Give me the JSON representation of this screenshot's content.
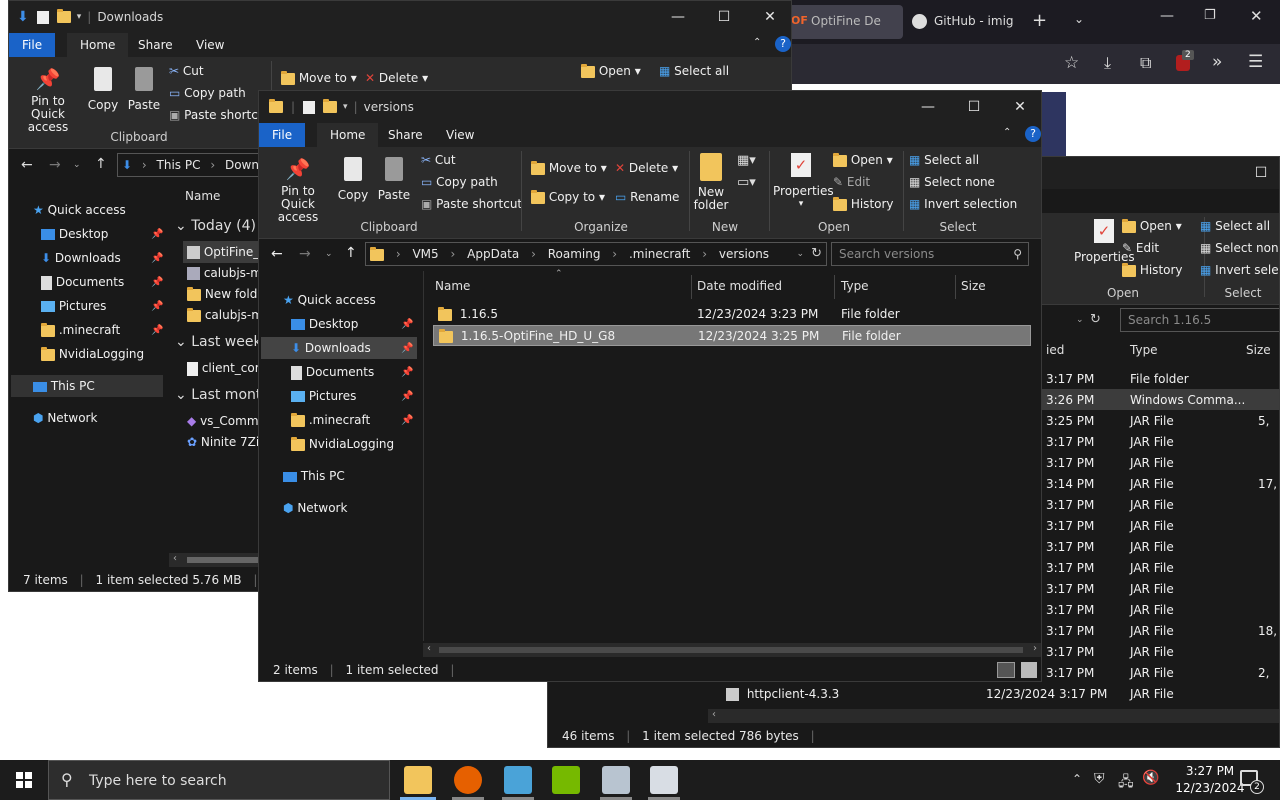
{
  "browser": {
    "tab1": "OptiFine De",
    "tab1_badge": "OF",
    "tab2": "GitHub - imig",
    "new_tab": "+",
    "ext_badge": "2"
  },
  "win_back": {
    "title": "Downloads",
    "tabs": [
      "File",
      "Home",
      "Share",
      "View"
    ],
    "ribbon": {
      "pin": "Pin to Quick access",
      "copy": "Copy",
      "paste": "Paste",
      "cut": "Cut",
      "copy_path": "Copy path",
      "paste_shortcut": "Paste shortcut",
      "clipboard": "Clipboard",
      "move_to": "Move to",
      "delete": "Delete",
      "open": "Open",
      "select_all": "Select all"
    },
    "address": [
      "This PC",
      "Downlo"
    ],
    "nav": [
      "Quick access",
      "Desktop",
      "Downloads",
      "Documents",
      "Pictures",
      ".minecraft",
      "NvidiaLogging",
      "This PC",
      "Network"
    ],
    "col_name": "Name",
    "groups": [
      "Today (4)",
      "Last week",
      "Last month"
    ],
    "files": [
      "OptiFine_",
      "calubjs-m",
      "New folde",
      "calubjs-m",
      "client_cor",
      "vs_Comm",
      "Ninite 7Zi"
    ],
    "status_items": "7 items",
    "status_sel": "1 item selected  5.76 MB"
  },
  "win_right": {
    "ribbon": {
      "properties": "Properties",
      "open": "Open",
      "edit": "Edit",
      "history": "History",
      "open_group": "Open",
      "select_all": "Select all",
      "select_none": "Select none",
      "invert": "Invert selecti",
      "select_group": "Select"
    },
    "search_placeholder": "Search 1.16.5",
    "col_modified": "ied",
    "col_type": "Type",
    "col_size": "Size",
    "rows": [
      {
        "time": "3:17 PM",
        "type": "File folder",
        "size": ""
      },
      {
        "time": "3:26 PM",
        "type": "Windows Comma...",
        "size": ""
      },
      {
        "time": "3:25 PM",
        "type": "JAR File",
        "size": "5,"
      },
      {
        "time": "3:17 PM",
        "type": "JAR File",
        "size": ""
      },
      {
        "time": "3:17 PM",
        "type": "JAR File",
        "size": ""
      },
      {
        "time": "3:14 PM",
        "type": "JAR File",
        "size": "17,"
      },
      {
        "time": "3:17 PM",
        "type": "JAR File",
        "size": ""
      },
      {
        "time": "3:17 PM",
        "type": "JAR File",
        "size": ""
      },
      {
        "time": "3:17 PM",
        "type": "JAR File",
        "size": ""
      },
      {
        "time": "3:17 PM",
        "type": "JAR File",
        "size": ""
      },
      {
        "time": "3:17 PM",
        "type": "JAR File",
        "size": ""
      },
      {
        "time": "3:17 PM",
        "type": "JAR File",
        "size": ""
      },
      {
        "time": "3:17 PM",
        "type": "JAR File",
        "size": "18,"
      },
      {
        "time": "3:17 PM",
        "type": "JAR File",
        "size": ""
      },
      {
        "time": "3:17 PM",
        "type": "JAR File",
        "size": "2,"
      }
    ],
    "last_row": {
      "name": "httpclient-4.3.3",
      "date": "12/23/2024 3:17 PM",
      "type": "JAR File"
    },
    "status_items": "46 items",
    "status_sel": "1 item selected  786 bytes"
  },
  "win_front": {
    "title": "versions",
    "tabs": [
      "File",
      "Home",
      "Share",
      "View"
    ],
    "ribbon": {
      "pin": "Pin to Quick access",
      "copy": "Copy",
      "paste": "Paste",
      "cut": "Cut",
      "copy_path": "Copy path",
      "paste_shortcut": "Paste shortcut",
      "clipboard": "Clipboard",
      "move_to": "Move to",
      "copy_to": "Copy to",
      "delete": "Delete",
      "rename": "Rename",
      "organize": "Organize",
      "new_folder": "New folder",
      "new": "New",
      "properties": "Properties",
      "open": "Open",
      "edit": "Edit",
      "history": "History",
      "open_group": "Open",
      "select_all": "Select all",
      "select_none": "Select none",
      "invert": "Invert selection",
      "select_group": "Select"
    },
    "address": [
      "VM5",
      "AppData",
      "Roaming",
      ".minecraft",
      "versions"
    ],
    "search_placeholder": "Search versions",
    "nav": [
      "Quick access",
      "Desktop",
      "Downloads",
      "Documents",
      "Pictures",
      ".minecraft",
      "NvidiaLogging",
      "This PC",
      "Network"
    ],
    "columns": [
      "Name",
      "Date modified",
      "Type",
      "Size"
    ],
    "rows": [
      {
        "name": "1.16.5",
        "date": "12/23/2024 3:23 PM",
        "type": "File folder"
      },
      {
        "name": "1.16.5-OptiFine_HD_U_G8",
        "date": "12/23/2024 3:25 PM",
        "type": "File folder"
      }
    ],
    "status_items": "2 items",
    "status_sel": "1 item selected"
  },
  "taskbar": {
    "search_placeholder": "Type here to search",
    "time": "3:27 PM",
    "date": "12/23/2024",
    "notif_count": "2"
  },
  "colors": {
    "accent": "#1a63c8",
    "selected_row": "#777777",
    "folder": "#f2c55c"
  }
}
